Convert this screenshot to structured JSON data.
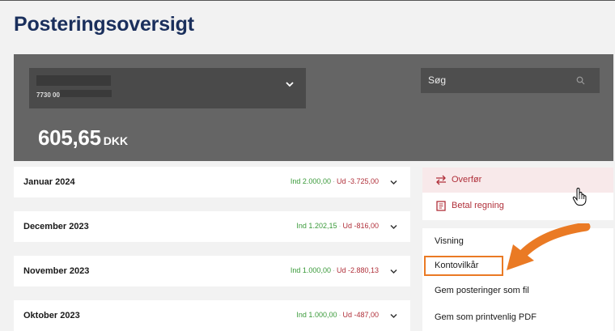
{
  "page": {
    "title": "Posteringsoversigt"
  },
  "account": {
    "number_prefix": "7730 00",
    "balance_amount": "605,65",
    "balance_currency": "DKK"
  },
  "search": {
    "placeholder": "Søg"
  },
  "months": [
    {
      "name": "Januar 2024",
      "in": "Ind 2.000,00",
      "out": "Ud -3.725,00"
    },
    {
      "name": "December 2023",
      "in": "Ind 1.202,15",
      "out": "Ud -816,00"
    },
    {
      "name": "November 2023",
      "in": "Ind 1.000,00",
      "out": "Ud -2.880,13"
    },
    {
      "name": "Oktober 2023",
      "in": "Ind 1.000,00",
      "out": "Ud -487,00"
    }
  ],
  "actions": [
    {
      "label": "Overfør",
      "icon": "transfer-arrows-icon"
    },
    {
      "label": "Betal regning",
      "icon": "bill-icon"
    }
  ],
  "options": [
    {
      "label": "Visning"
    },
    {
      "label": "Kontovilkår"
    },
    {
      "label": "Gem posteringer som fil"
    },
    {
      "label": "Gem som printvenlig PDF"
    }
  ],
  "colors": {
    "title": "#1a2f5c",
    "card": "#656565",
    "income": "#3a9a3a",
    "expense": "#b0303a",
    "annotation": "#ea7a24"
  }
}
